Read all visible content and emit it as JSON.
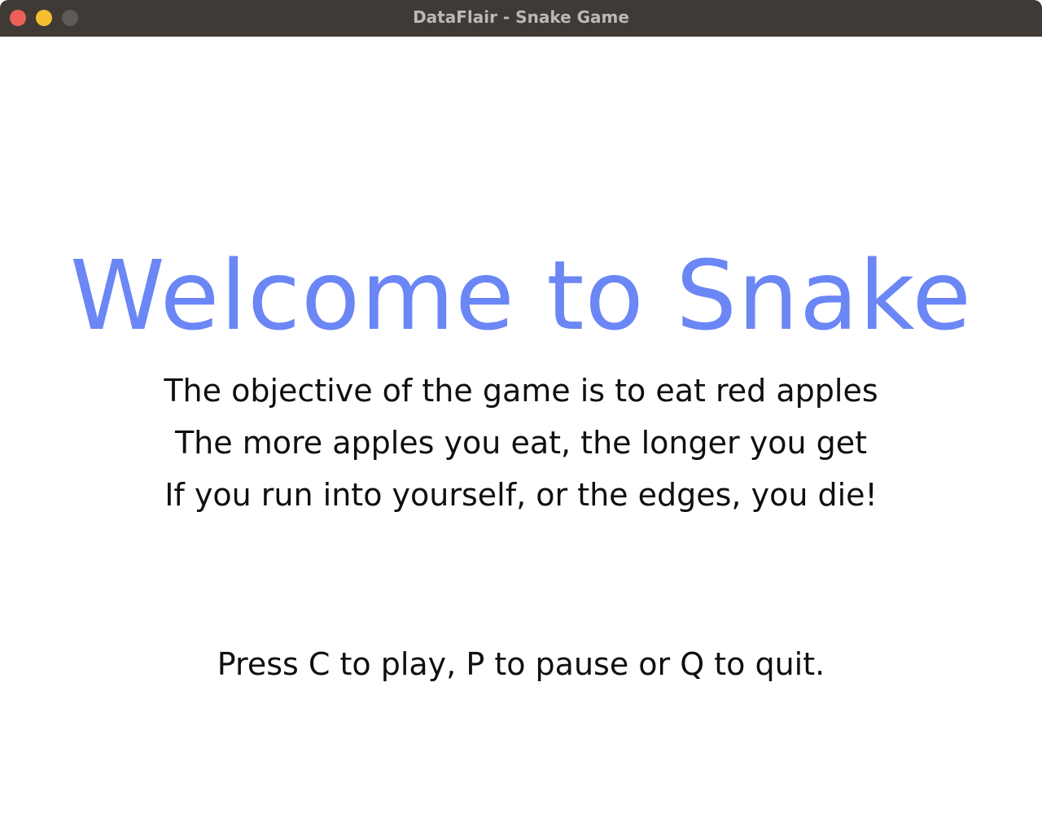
{
  "window": {
    "title": "DataFlair - Snake Game"
  },
  "game": {
    "headline": "Welcome to Snake",
    "instructions": [
      "The objective of the game is to eat red apples",
      "The more apples you eat, the longer you get",
      "If you run into yourself, or the edges, you die!"
    ],
    "controls": "Press C to play, P to pause or Q to quit."
  },
  "colors": {
    "headline": "#6b86f5",
    "text": "#0f0f0f",
    "background": "#ffffff",
    "titlebar": "#3f3a36"
  }
}
